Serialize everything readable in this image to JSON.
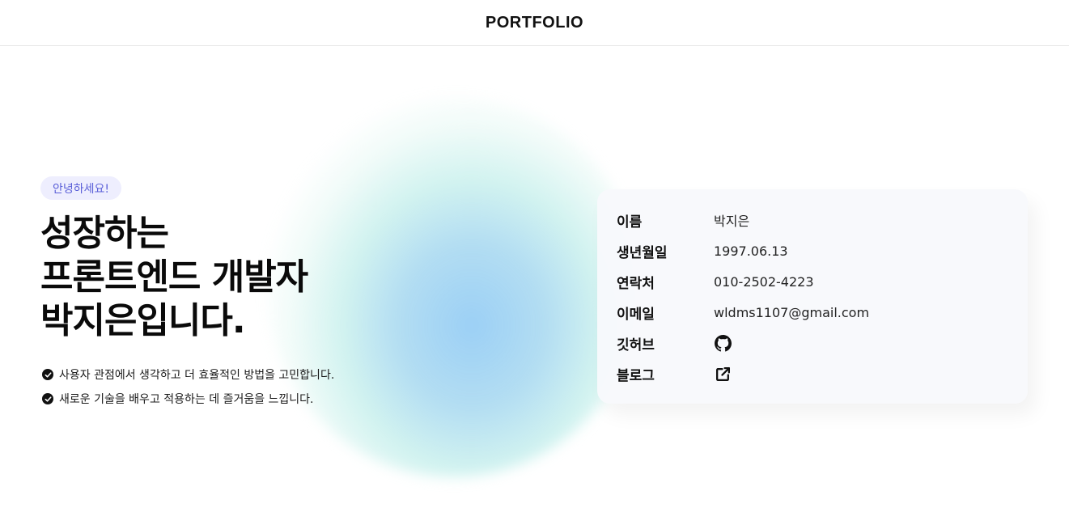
{
  "header": {
    "title": "PORTFOLIO"
  },
  "hero": {
    "badge": "안녕하세요!",
    "title_lines": [
      "성장하는",
      "프론트엔드 개발자",
      "박지은입니다."
    ],
    "points": [
      "사용자 관점에서 생각하고 더 효율적인 방법을 고민합니다.",
      "새로운 기술을 배우고 적용하는 데 즐거움을 느낍니다."
    ]
  },
  "profile": {
    "rows": [
      {
        "label": "이름",
        "value": "박지은"
      },
      {
        "label": "생년월일",
        "value": "1997.06.13"
      },
      {
        "label": "연락처",
        "value": "010-2502-4223"
      },
      {
        "label": "이메일",
        "value": "wldms1107@gmail.com"
      },
      {
        "label": "깃허브",
        "icon": "github-icon"
      },
      {
        "label": "블로그",
        "icon": "external-link-icon"
      }
    ]
  },
  "colors": {
    "badge_bg": "#eeeefe",
    "badge_text": "#5a5fd8",
    "card_bg": "#f8f9fc"
  }
}
